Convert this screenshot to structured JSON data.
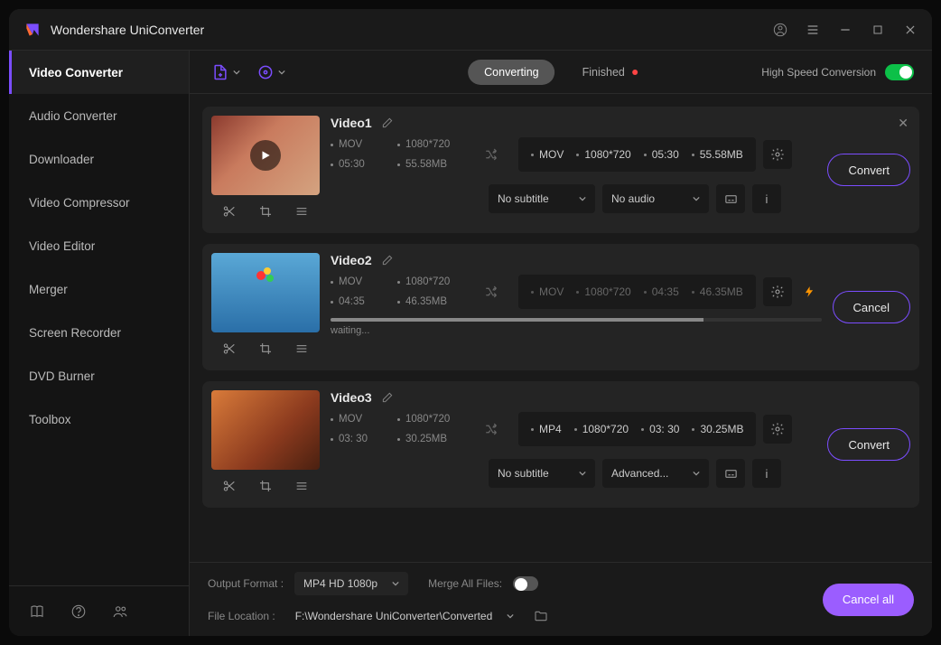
{
  "header": {
    "title": "Wondershare UniConverter"
  },
  "sidebar": {
    "items": [
      {
        "label": "Video Converter"
      },
      {
        "label": "Audio Converter"
      },
      {
        "label": "Downloader"
      },
      {
        "label": "Video Compressor"
      },
      {
        "label": "Video Editor"
      },
      {
        "label": "Merger"
      },
      {
        "label": "Screen Recorder"
      },
      {
        "label": "DVD Burner"
      },
      {
        "label": "Toolbox"
      }
    ]
  },
  "toolbar": {
    "tabs": {
      "converting": "Converting",
      "finished": "Finished"
    },
    "hsc": "High Speed Conversion"
  },
  "videos": [
    {
      "title": "Video1",
      "src": {
        "format": "MOV",
        "resolution": "1080*720",
        "duration": "05:30",
        "size": "55.58MB"
      },
      "out": {
        "format": "MOV",
        "resolution": "1080*720",
        "duration": "05:30",
        "size": "55.58MB"
      },
      "subtitle": "No subtitle",
      "audio": "No audio",
      "action": "Convert"
    },
    {
      "title": "Video2",
      "src": {
        "format": "MOV",
        "resolution": "1080*720",
        "duration": "04:35",
        "size": "46.35MB"
      },
      "out": {
        "format": "MOV",
        "resolution": "1080*720",
        "duration": "04:35",
        "size": "46.35MB"
      },
      "status": "waiting...",
      "action": "Cancel"
    },
    {
      "title": "Video3",
      "src": {
        "format": "MOV",
        "resolution": "1080*720",
        "duration": "03: 30",
        "size": "30.25MB"
      },
      "out": {
        "format": "MP4",
        "resolution": "1080*720",
        "duration": "03: 30",
        "size": "30.25MB"
      },
      "subtitle": "No subtitle",
      "audio": "Advanced...",
      "action": "Convert"
    }
  ],
  "bottombar": {
    "output_format_label": "Output Format :",
    "output_format": "MP4 HD 1080p",
    "merge_label": "Merge All Files:",
    "location_label": "File Location :",
    "location": "F:\\Wondershare UniConverter\\Converted",
    "cancel_all": "Cancel all"
  }
}
